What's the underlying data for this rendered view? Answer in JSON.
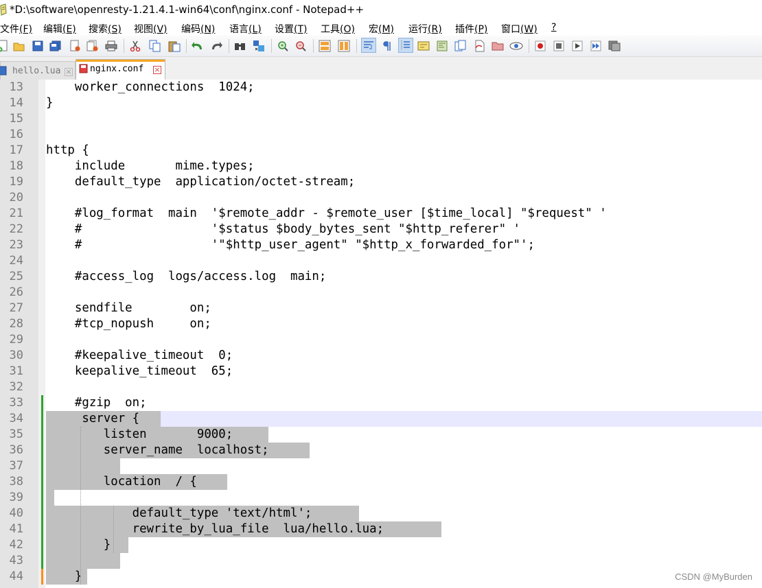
{
  "window": {
    "title": "*D:\\software\\openresty-1.21.4.1-win64\\conf\\nginx.conf - Notepad++"
  },
  "menu": [
    {
      "label": "文件",
      "mnemonic": "(F)"
    },
    {
      "label": "编辑",
      "mnemonic": "(E)"
    },
    {
      "label": "搜索",
      "mnemonic": "(S)"
    },
    {
      "label": "视图",
      "mnemonic": "(V)"
    },
    {
      "label": "编码",
      "mnemonic": "(N)"
    },
    {
      "label": "语言",
      "mnemonic": "(L)"
    },
    {
      "label": "设置",
      "mnemonic": "(T)"
    },
    {
      "label": "工具",
      "mnemonic": "(O)"
    },
    {
      "label": "宏",
      "mnemonic": "(M)"
    },
    {
      "label": "运行",
      "mnemonic": "(R)"
    },
    {
      "label": "插件",
      "mnemonic": "(P)"
    },
    {
      "label": "窗口",
      "mnemonic": "(W)"
    },
    {
      "label": "",
      "mnemonic": "?"
    }
  ],
  "toolbar": [
    "new-file-icon",
    "open-file-icon",
    "save-icon",
    "save-all-icon",
    "close-icon",
    "close-all-icon",
    "print-icon",
    "cut-icon",
    "copy-icon",
    "paste-icon",
    "undo-icon",
    "redo-icon",
    "find-icon",
    "replace-icon",
    "zoom-in-icon",
    "zoom-out-icon",
    "sync-vertical-icon",
    "sync-horizontal-icon",
    "word-wrap-icon",
    "show-all-chars-icon",
    "indent-guide-icon",
    "user-lang-icon",
    "doc-map-icon",
    "function-list-icon",
    "folder-workspace-icon",
    "monitor-icon",
    "record-macro-icon",
    "stop-macro-icon",
    "play-macro-icon",
    "run-macro-multiple-icon",
    "save-macro-icon"
  ],
  "tabs": [
    {
      "label": "hello.lua",
      "active": false
    },
    {
      "label": "nginx.conf",
      "active": true
    }
  ],
  "editor": {
    "lines": [
      {
        "num": "13",
        "text": "    worker_connections  1024;"
      },
      {
        "num": "14",
        "text": "}"
      },
      {
        "num": "15",
        "text": ""
      },
      {
        "num": "16",
        "text": ""
      },
      {
        "num": "17",
        "text": "http {"
      },
      {
        "num": "18",
        "text": "    include       mime.types;"
      },
      {
        "num": "19",
        "text": "    default_type  application/octet-stream;"
      },
      {
        "num": "20",
        "text": ""
      },
      {
        "num": "21",
        "text": "    #log_format  main  '$remote_addr - $remote_user [$time_local] \"$request\" '"
      },
      {
        "num": "22",
        "text": "    #                  '$status $body_bytes_sent \"$http_referer\" '"
      },
      {
        "num": "23",
        "text": "    #                  '\"$http_user_agent\" \"$http_x_forwarded_for\"';"
      },
      {
        "num": "24",
        "text": ""
      },
      {
        "num": "25",
        "text": "    #access_log  logs/access.log  main;"
      },
      {
        "num": "26",
        "text": ""
      },
      {
        "num": "27",
        "text": "    sendfile        on;"
      },
      {
        "num": "28",
        "text": "    #tcp_nopush     on;"
      },
      {
        "num": "29",
        "text": ""
      },
      {
        "num": "30",
        "text": "    #keepalive_timeout  0;"
      },
      {
        "num": "31",
        "text": "    keepalive_timeout  65;"
      },
      {
        "num": "32",
        "text": ""
      },
      {
        "num": "33",
        "text": "    #gzip  on;"
      },
      {
        "num": "34",
        "text": "     server {"
      },
      {
        "num": "35",
        "text": "        listen       9000;"
      },
      {
        "num": "36",
        "text": "        server_name  localhost;"
      },
      {
        "num": "37",
        "text": ""
      },
      {
        "num": "38",
        "text": "        location  / {"
      },
      {
        "num": "39",
        "text": ""
      },
      {
        "num": "40",
        "text": "            default_type 'text/html';"
      },
      {
        "num": "41",
        "text": "            rewrite_by_lua_file  lua/hello.lua;"
      },
      {
        "num": "42",
        "text": "        }"
      },
      {
        "num": "43",
        "text": ""
      },
      {
        "num": "44",
        "text": "    }"
      }
    ]
  },
  "watermark": "CSDN @MyBurden",
  "colors": {
    "selection": "#c0c0c0",
    "caret_line": "#e8e8ff",
    "change_saved": "#2aa52a",
    "change_unsaved": "#ff8c1a",
    "active_tab_accent": "#f5a623",
    "gutter": "#e4e4e4"
  }
}
